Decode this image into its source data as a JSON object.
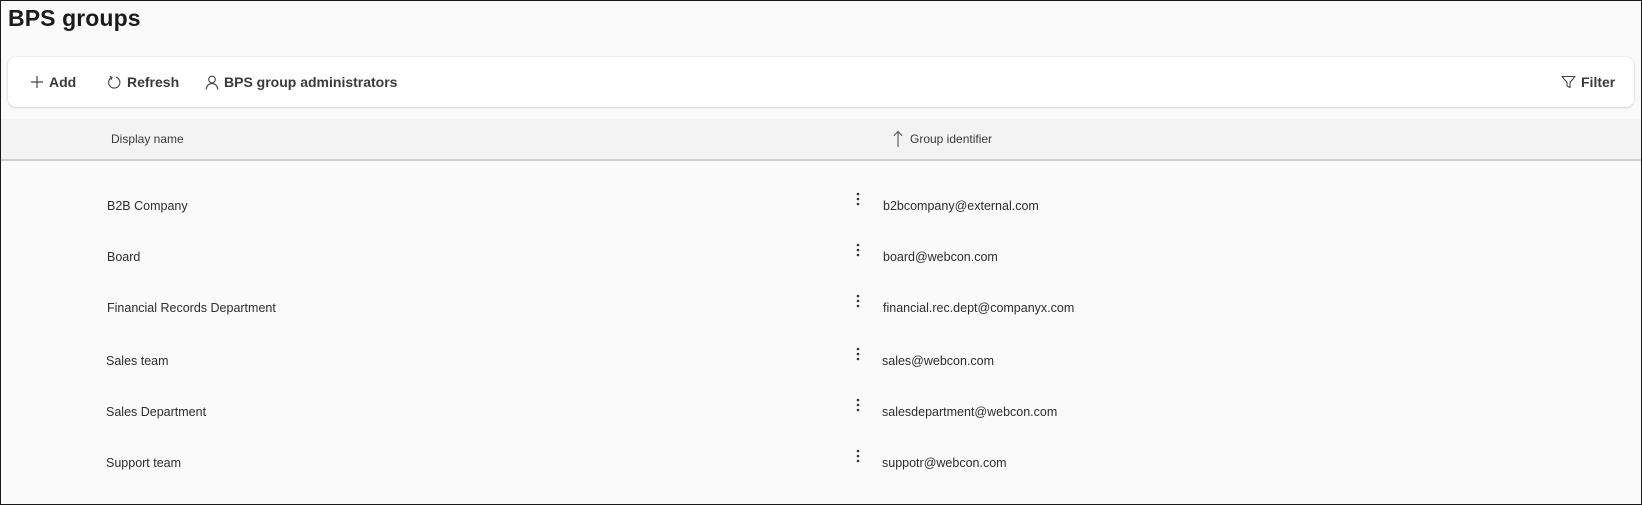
{
  "page": {
    "title": "BPS groups"
  },
  "toolbar": {
    "add_label": "Add",
    "refresh_label": "Refresh",
    "admins_label": "BPS group administrators",
    "filter_label": "Filter"
  },
  "grid": {
    "columns": [
      {
        "label": "Display name",
        "sort": "none"
      },
      {
        "label": "Group identifier",
        "sort": "ascending"
      }
    ],
    "rows": [
      {
        "display_name": "B2B Company",
        "group_identifier": "b2bcompany@external.com"
      },
      {
        "display_name": "Board",
        "group_identifier": "board@webcon.com"
      },
      {
        "display_name": "Financial Records Department",
        "group_identifier": "financial.rec.dept@companyx.com"
      },
      {
        "display_name": "Sales team",
        "group_identifier": "sales@webcon.com"
      },
      {
        "display_name": "Sales Department",
        "group_identifier": "salesdepartment@webcon.com"
      },
      {
        "display_name": "Support team",
        "group_identifier": "suppotr@webcon.com"
      }
    ]
  },
  "icons": {
    "add": "plus-icon",
    "refresh": "refresh-icon",
    "admins": "person-icon",
    "filter": "filter-icon",
    "sort": "arrow-up-icon",
    "row_menu": "more-vertical-icon"
  }
}
